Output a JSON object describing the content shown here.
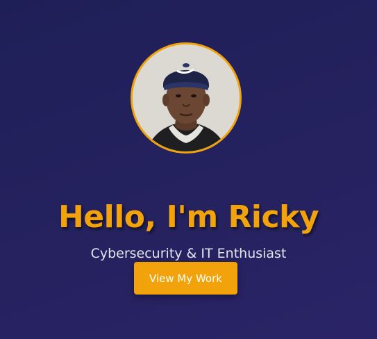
{
  "hero": {
    "greeting": "Hello, I'm Ricky",
    "tagline": "Cybersecurity & IT Enthusiast",
    "cta_label": "View My Work"
  },
  "colors": {
    "background": "#24215c",
    "accent": "#f2a20a",
    "text_light": "#e4e4ef"
  }
}
